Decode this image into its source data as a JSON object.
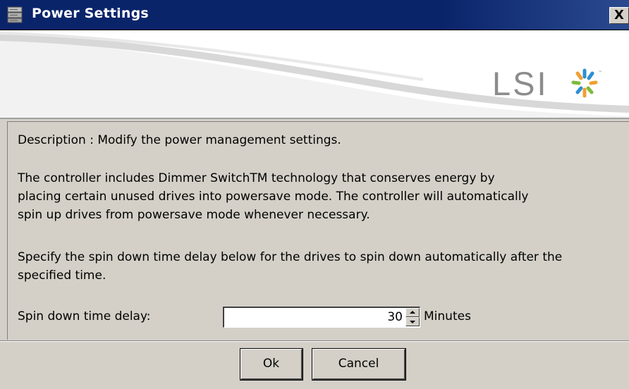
{
  "window": {
    "title": "Power Settings",
    "close_label": "X",
    "title_bar_color": "#0a246a",
    "icons": {
      "app": "server-icon",
      "close": "close-icon"
    }
  },
  "banner": {
    "logo_text": "LSI",
    "logo_icon": "lsi-star-logo-icon",
    "colors": {
      "star_blue": "#2e8fd1",
      "star_orange": "#f0a030",
      "star_green": "#7dbb3c",
      "text_gray": "#8c8c8c"
    }
  },
  "content": {
    "description": "Description : Modify the power management settings.",
    "technology_text": [
      "The controller includes Dimmer SwitchTM technology that conserves energy by",
      "placing certain unused drives into powersave mode. The controller will automatically",
      "spin up drives from powersave mode whenever necessary."
    ],
    "spin_instruction": [
      "Specify the spin down time delay below for the drives to spin down automatically after the",
      "specified time."
    ],
    "spin_field": {
      "label": "Spin down time delay:",
      "value": "30",
      "unit": "Minutes"
    }
  },
  "buttons": {
    "ok_label": "Ok",
    "cancel_label": "Cancel"
  }
}
